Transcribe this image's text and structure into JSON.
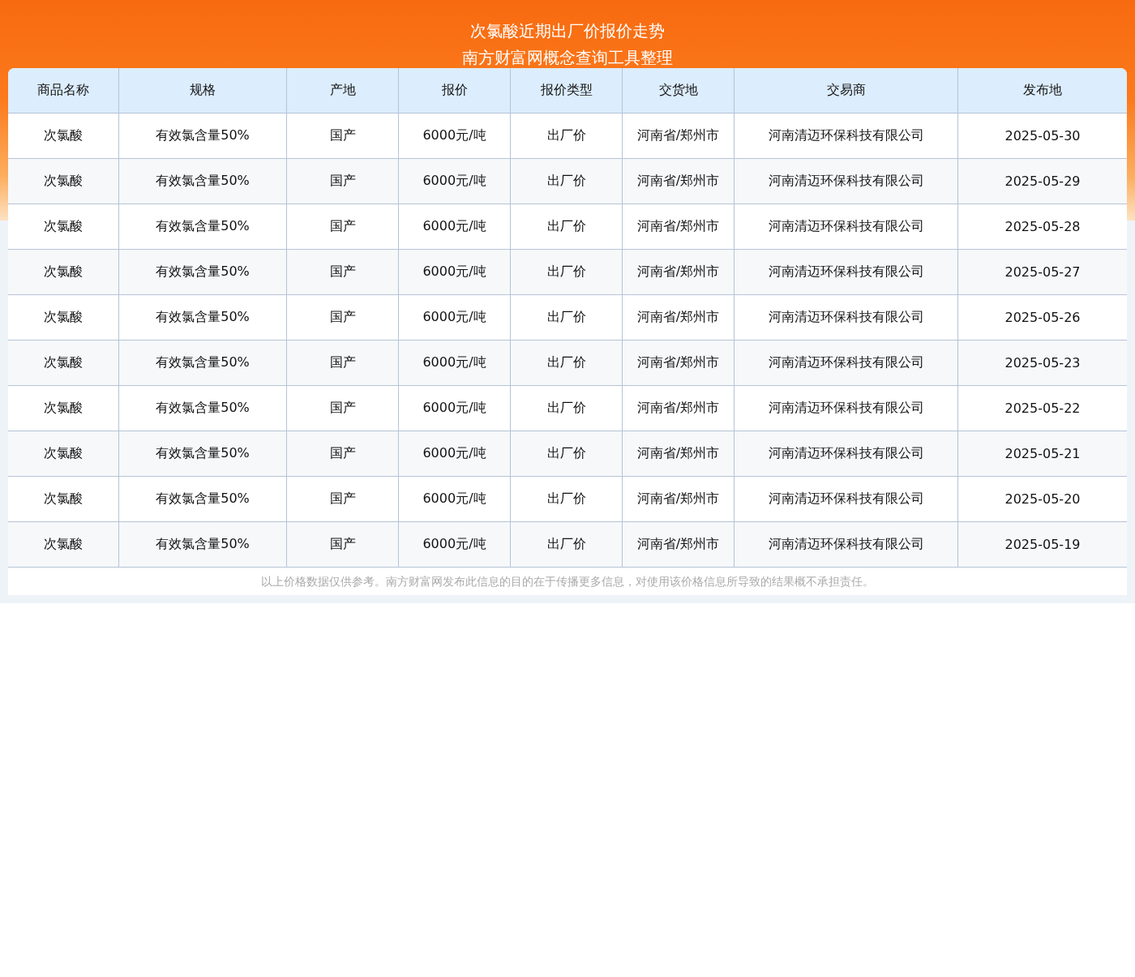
{
  "header": {
    "title": "次氯酸近期出厂价报价走势",
    "subtitle": "南方财富网概念查询工具整理"
  },
  "table": {
    "columns": [
      "商品名称",
      "规格",
      "产地",
      "报价",
      "报价类型",
      "交货地",
      "交易商",
      "发布地"
    ],
    "rows": [
      [
        "次氯酸",
        "有效氯含量50%",
        "国产",
        "6000元/吨",
        "出厂价",
        "河南省/郑州市",
        "河南清迈环保科技有限公司",
        "2025-05-30"
      ],
      [
        "次氯酸",
        "有效氯含量50%",
        "国产",
        "6000元/吨",
        "出厂价",
        "河南省/郑州市",
        "河南清迈环保科技有限公司",
        "2025-05-29"
      ],
      [
        "次氯酸",
        "有效氯含量50%",
        "国产",
        "6000元/吨",
        "出厂价",
        "河南省/郑州市",
        "河南清迈环保科技有限公司",
        "2025-05-28"
      ],
      [
        "次氯酸",
        "有效氯含量50%",
        "国产",
        "6000元/吨",
        "出厂价",
        "河南省/郑州市",
        "河南清迈环保科技有限公司",
        "2025-05-27"
      ],
      [
        "次氯酸",
        "有效氯含量50%",
        "国产",
        "6000元/吨",
        "出厂价",
        "河南省/郑州市",
        "河南清迈环保科技有限公司",
        "2025-05-26"
      ],
      [
        "次氯酸",
        "有效氯含量50%",
        "国产",
        "6000元/吨",
        "出厂价",
        "河南省/郑州市",
        "河南清迈环保科技有限公司",
        "2025-05-23"
      ],
      [
        "次氯酸",
        "有效氯含量50%",
        "国产",
        "6000元/吨",
        "出厂价",
        "河南省/郑州市",
        "河南清迈环保科技有限公司",
        "2025-05-22"
      ],
      [
        "次氯酸",
        "有效氯含量50%",
        "国产",
        "6000元/吨",
        "出厂价",
        "河南省/郑州市",
        "河南清迈环保科技有限公司",
        "2025-05-21"
      ],
      [
        "次氯酸",
        "有效氯含量50%",
        "国产",
        "6000元/吨",
        "出厂价",
        "河南省/郑州市",
        "河南清迈环保科技有限公司",
        "2025-05-20"
      ],
      [
        "次氯酸",
        "有效氯含量50%",
        "国产",
        "6000元/吨",
        "出厂价",
        "河南省/郑州市",
        "河南清迈环保科技有限公司",
        "2025-05-19"
      ]
    ]
  },
  "footer_note": "以上价格数据仅供参考。南方财富网发布此信息的目的在于传播更多信息，对使用该价格信息所导致的结果概不承担责任。"
}
